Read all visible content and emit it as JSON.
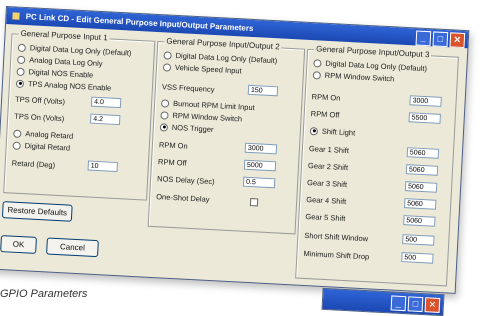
{
  "window": {
    "title": "PC Link CD - Edit General Purpose Input/Output Parameters",
    "buttons": {
      "minimize": "_",
      "maximize": "□",
      "close": "✕"
    }
  },
  "gpio1": {
    "title": "General Purpose Input 1",
    "modes": [
      {
        "label": "Digital Data Log Only (Default)",
        "selected": false
      },
      {
        "label": "Analog Data Log Only",
        "selected": false
      },
      {
        "label": "Digital NOS Enable",
        "selected": false
      },
      {
        "label": "TPS Analog NOS Enable",
        "selected": true
      }
    ],
    "tps_off_label": "TPS Off (Volts)",
    "tps_off_value": "4.0",
    "tps_on_label": "TPS On (Volts)",
    "tps_on_value": "4.2",
    "retard_modes": [
      {
        "label": "Analog Retard",
        "selected": false
      },
      {
        "label": "Digital Retard",
        "selected": false
      }
    ],
    "retard_label": "Retard (Deg)",
    "retard_value": "10"
  },
  "gpio2": {
    "title": "General Purpose Input/Output 2",
    "modes": [
      {
        "label": "Digital Data Log Only (Default)",
        "selected": false
      },
      {
        "label": "Vehicle Speed Input",
        "selected": false
      }
    ],
    "vss_label": "VSS Frequency",
    "vss_value": "150",
    "outputs": [
      {
        "label": "Burnout RPM Limit Input",
        "selected": false
      },
      {
        "label": "RPM Window Switch",
        "selected": false
      },
      {
        "label": "NOS Trigger",
        "selected": true
      }
    ],
    "rpm_on_label": "RPM On",
    "rpm_on_value": "3000",
    "rpm_off_label": "RPM Off",
    "rpm_off_value": "5000",
    "nos_delay_label": "NOS Delay (Sec)",
    "nos_delay_value": "0.5",
    "oneshot_label": "One-Shot Delay"
  },
  "gpio3": {
    "title": "General Purpose Input/Output 3",
    "modes": [
      {
        "label": "Digital Data Log Only (Default)",
        "selected": false
      },
      {
        "label": "RPM Window Switch",
        "selected": false
      }
    ],
    "rpm_on_label": "RPM On",
    "rpm_on_value": "3000",
    "rpm_off_label": "RPM Off",
    "rpm_off_value": "5500",
    "shift_light_label": "Shift Light",
    "gears": [
      {
        "label": "Gear 1 Shift",
        "value": "5060"
      },
      {
        "label": "Gear 2 Shift",
        "value": "5060"
      },
      {
        "label": "Gear 3 Shift",
        "value": "5060"
      },
      {
        "label": "Gear 4 Shift",
        "value": "5060"
      },
      {
        "label": "Gear 5 Shift",
        "value": "5060"
      }
    ],
    "short_window_label": "Short Shift Window",
    "short_window_value": "500",
    "min_drop_label": "Minimum Shift Drop",
    "min_drop_value": "500"
  },
  "actions": {
    "restore": "Restore Defaults",
    "ok": "OK",
    "cancel": "Cancel"
  },
  "caption": "GPIO Parameters"
}
